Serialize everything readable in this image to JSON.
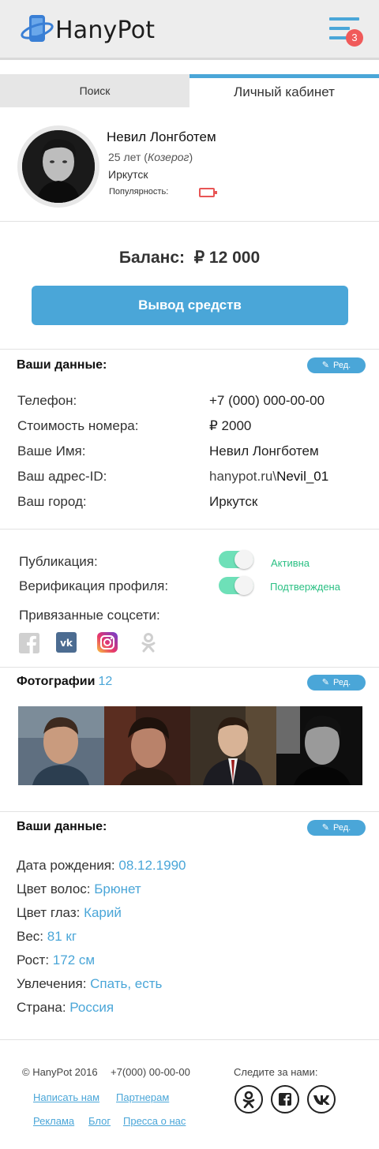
{
  "header": {
    "logo_text": "HanyPot",
    "menu_badge": "3",
    "colors": {
      "accent": "#4aa6d8",
      "badge": "#f05a5a",
      "bg": "#ededed"
    }
  },
  "tabs": [
    {
      "label": "Поиск",
      "active": false
    },
    {
      "label": "Личный кабинет",
      "active": true
    }
  ],
  "profile": {
    "name": "Невил Лонгботем",
    "age": "25 лет",
    "zodiac": "Козерог",
    "city": "Иркутск",
    "popularity_label": "Популярность:"
  },
  "balance": {
    "label": "Баланс:  ₽ 12 000",
    "withdraw_button": "Вывод средств"
  },
  "your_data": {
    "title": "Ваши данные:",
    "edit_label": "Ред.",
    "rows": [
      {
        "label": "Телефон:",
        "value": "+7 (000) 000-00-00"
      },
      {
        "label": "Стоимость номера:",
        "value": "₽ 2000"
      },
      {
        "label": "Ваше Имя:",
        "value": "Невил Лонгботем"
      },
      {
        "label": "Ваш адрес-ID:",
        "value_prefix": "hanypot.ru\\",
        "value_strong": "Nevil_01"
      },
      {
        "label": "Ваш город:",
        "value": "Иркутск"
      }
    ]
  },
  "settings": {
    "publication_label": "Публикация:",
    "publication_status": "Активна",
    "verification_label": "Верификация профиля:",
    "verification_status": "Подтверждена",
    "linked_social_label": "Привязанные соцсети:",
    "socials": [
      "facebook-icon",
      "vk-icon",
      "instagram-icon",
      "odnoklassniki-icon"
    ],
    "status_color": "#2cc084"
  },
  "photos": {
    "title": "Фотографии",
    "count": "12",
    "edit_label": "Ред."
  },
  "your_data_2": {
    "title": "Ваши данные:",
    "edit_label": "Ред.",
    "rows": [
      {
        "label": "Дата рождения:",
        "value": "08.12.1990"
      },
      {
        "label": "Цвет волос:",
        "value": "Брюнет"
      },
      {
        "label": "Цвет глаз:",
        "value": "Карий"
      },
      {
        "label": "Вес:",
        "value": "81 кг"
      },
      {
        "label": "Рост:",
        "value": "172 см"
      },
      {
        "label": "Увлечения:",
        "value": "Спать, есть"
      },
      {
        "label": "Страна:",
        "value": "Россия"
      }
    ]
  },
  "footer": {
    "copyright": "© HanyPot 2016",
    "phone": "+7(000) 00-00-00",
    "follow_label": "Следите за нами:",
    "links": [
      "Написать нам",
      "Партнерам",
      "Реклама",
      "Блог",
      "Пресса о нас"
    ]
  }
}
